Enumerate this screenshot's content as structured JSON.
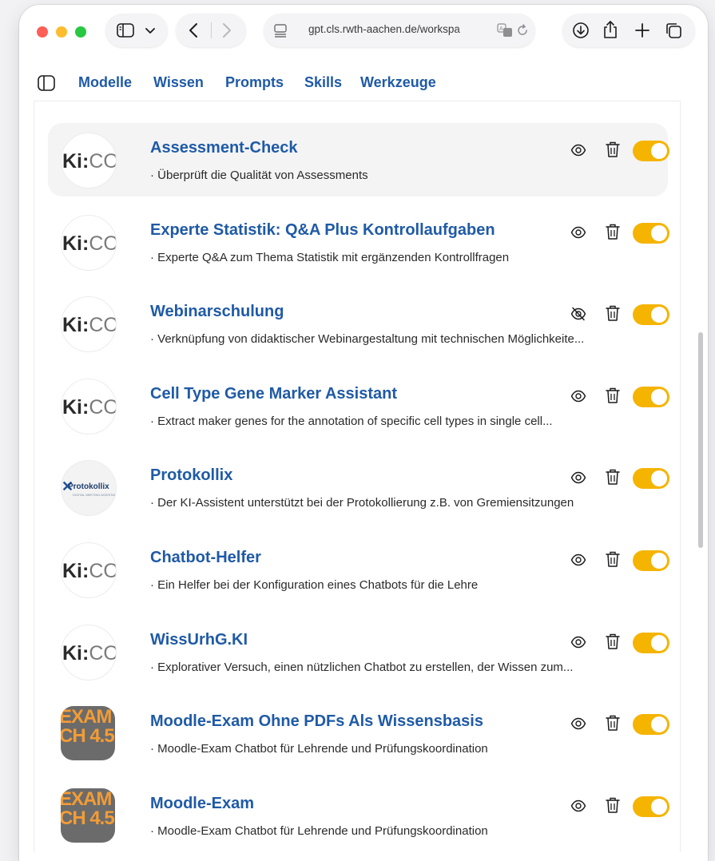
{
  "browser": {
    "url": "gpt.cls.rwth-aachen.de/workspa",
    "accent_red": "#ff5f57",
    "accent_yellow": "#febc2e",
    "accent_green": "#28c840"
  },
  "nav": {
    "items": [
      "Modelle",
      "Wissen",
      "Prompts",
      "Skills",
      "Werkzeuge"
    ]
  },
  "theme": {
    "link_color": "#1f5aa6",
    "toggle_color": "#f5b400"
  },
  "logos": {
    "kico_ki": "Ki:",
    "kico_co": "CO",
    "protokollix": "Protokollix",
    "protokollix_sub": "DIGITAL MEETING ASSISTANT",
    "exam_line1": "EXAM",
    "exam_line2": "CH 4.5"
  },
  "models": [
    {
      "title": "Assessment-Check",
      "description": "· Überprüft die Qualität von Assessments",
      "logo": "kico",
      "visible": true,
      "enabled": true
    },
    {
      "title": "Experte Statistik: Q&A Plus Kontrollaufgaben",
      "description": "· Experte Q&A zum Thema Statistik mit ergänzenden Kontrollfragen",
      "logo": "kico",
      "visible": true,
      "enabled": true
    },
    {
      "title": "Webinarschulung",
      "description": "· Verknüpfung von didaktischer Webinargestaltung mit technischen Möglichkeite...",
      "logo": "kico",
      "visible": false,
      "enabled": true
    },
    {
      "title": "Cell Type Gene Marker Assistant",
      "description": "· Extract maker genes for the annotation of specific cell types in single cell...",
      "logo": "kico",
      "visible": true,
      "enabled": true
    },
    {
      "title": "Protokollix",
      "description": "· Der KI-Assistent unterstützt bei der Protokollierung z.B. von Gremiensitzungen",
      "logo": "protokollix",
      "visible": true,
      "enabled": true
    },
    {
      "title": "Chatbot-Helfer",
      "description": "· Ein Helfer bei der Konfiguration eines Chatbots für die Lehre",
      "logo": "kico",
      "visible": true,
      "enabled": true
    },
    {
      "title": "WissUrhG.KI",
      "description": "· Explorativer Versuch, einen nützlichen Chatbot zu erstellen, der Wissen zum...",
      "logo": "kico",
      "visible": true,
      "enabled": true
    },
    {
      "title": "Moodle-Exam Ohne PDFs Als Wissensbasis",
      "description": "· Moodle-Exam Chatbot für Lehrende und Prüfungskoordination",
      "logo": "exam",
      "visible": true,
      "enabled": true
    },
    {
      "title": "Moodle-Exam",
      "description": "· Moodle-Exam Chatbot für Lehrende und Prüfungskoordination",
      "logo": "exam",
      "visible": true,
      "enabled": true
    }
  ]
}
